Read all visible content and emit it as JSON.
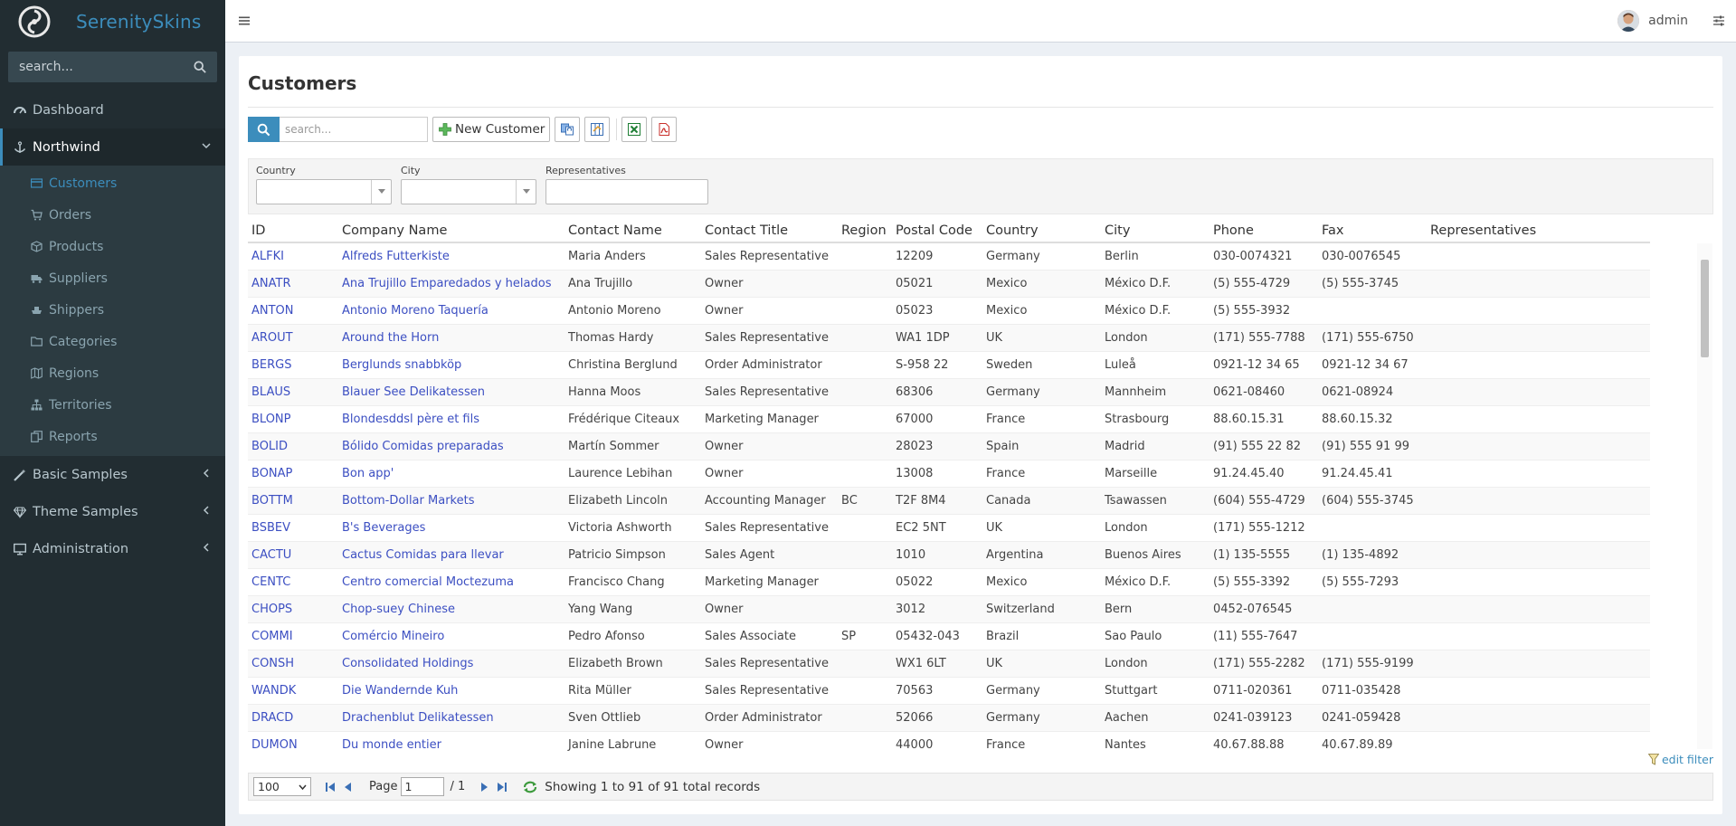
{
  "app": {
    "brand": "SerenitySkins"
  },
  "sidebar": {
    "search_placeholder": "search...",
    "items": [
      {
        "label": "Dashboard"
      },
      {
        "label": "Northwind"
      },
      {
        "label": "Basic Samples"
      },
      {
        "label": "Theme Samples"
      },
      {
        "label": "Administration"
      }
    ],
    "northwind_children": [
      {
        "label": "Customers"
      },
      {
        "label": "Orders"
      },
      {
        "label": "Products"
      },
      {
        "label": "Suppliers"
      },
      {
        "label": "Shippers"
      },
      {
        "label": "Categories"
      },
      {
        "label": "Regions"
      },
      {
        "label": "Territories"
      },
      {
        "label": "Reports"
      }
    ]
  },
  "header": {
    "user_name": "admin"
  },
  "page": {
    "title": "Customers"
  },
  "toolbar": {
    "search_placeholder": "search...",
    "new_button": "New Customer"
  },
  "filters": {
    "country_label": "Country",
    "city_label": "City",
    "representatives_label": "Representatives"
  },
  "grid": {
    "columns": [
      "ID",
      "Company Name",
      "Contact Name",
      "Contact Title",
      "Region",
      "Postal Code",
      "Country",
      "City",
      "Phone",
      "Fax",
      "Representatives"
    ],
    "rows": [
      [
        "ALFKI",
        "Alfreds Futterkiste",
        "Maria Anders",
        "Sales Representative",
        "",
        "12209",
        "Germany",
        "Berlin",
        "030-0074321",
        "030-0076545",
        ""
      ],
      [
        "ANATR",
        "Ana Trujillo Emparedados y helados",
        "Ana Trujillo",
        "Owner",
        "",
        "05021",
        "Mexico",
        "México D.F.",
        "(5) 555-4729",
        "(5) 555-3745",
        ""
      ],
      [
        "ANTON",
        "Antonio Moreno Taquería",
        "Antonio Moreno",
        "Owner",
        "",
        "05023",
        "Mexico",
        "México D.F.",
        "(5) 555-3932",
        "",
        ""
      ],
      [
        "AROUT",
        "Around the Horn",
        "Thomas Hardy",
        "Sales Representative",
        "",
        "WA1 1DP",
        "UK",
        "London",
        "(171) 555-7788",
        "(171) 555-6750",
        ""
      ],
      [
        "BERGS",
        "Berglunds snabbköp",
        "Christina Berglund",
        "Order Administrator",
        "",
        "S-958 22",
        "Sweden",
        "Luleå",
        "0921-12 34 65",
        "0921-12 34 67",
        ""
      ],
      [
        "BLAUS",
        "Blauer See Delikatessen",
        "Hanna Moos",
        "Sales Representative",
        "",
        "68306",
        "Germany",
        "Mannheim",
        "0621-08460",
        "0621-08924",
        ""
      ],
      [
        "BLONP",
        "Blondesddsl père et fils",
        "Frédérique Citeaux",
        "Marketing Manager",
        "",
        "67000",
        "France",
        "Strasbourg",
        "88.60.15.31",
        "88.60.15.32",
        ""
      ],
      [
        "BOLID",
        "Bólido Comidas preparadas",
        "Martín Sommer",
        "Owner",
        "",
        "28023",
        "Spain",
        "Madrid",
        "(91) 555 22 82",
        "(91) 555 91 99",
        ""
      ],
      [
        "BONAP",
        "Bon app'",
        "Laurence Lebihan",
        "Owner",
        "",
        "13008",
        "France",
        "Marseille",
        "91.24.45.40",
        "91.24.45.41",
        ""
      ],
      [
        "BOTTM",
        "Bottom-Dollar Markets",
        "Elizabeth Lincoln",
        "Accounting Manager",
        "BC",
        "T2F 8M4",
        "Canada",
        "Tsawassen",
        "(604) 555-4729",
        "(604) 555-3745",
        ""
      ],
      [
        "BSBEV",
        "B's Beverages",
        "Victoria Ashworth",
        "Sales Representative",
        "",
        "EC2 5NT",
        "UK",
        "London",
        "(171) 555-1212",
        "",
        ""
      ],
      [
        "CACTU",
        "Cactus Comidas para llevar",
        "Patricio Simpson",
        "Sales Agent",
        "",
        "1010",
        "Argentina",
        "Buenos Aires",
        "(1) 135-5555",
        "(1) 135-4892",
        ""
      ],
      [
        "CENTC",
        "Centro comercial Moctezuma",
        "Francisco Chang",
        "Marketing Manager",
        "",
        "05022",
        "Mexico",
        "México D.F.",
        "(5) 555-3392",
        "(5) 555-7293",
        ""
      ],
      [
        "CHOPS",
        "Chop-suey Chinese",
        "Yang Wang",
        "Owner",
        "",
        "3012",
        "Switzerland",
        "Bern",
        "0452-076545",
        "",
        ""
      ],
      [
        "COMMI",
        "Comércio Mineiro",
        "Pedro Afonso",
        "Sales Associate",
        "SP",
        "05432-043",
        "Brazil",
        "Sao Paulo",
        "(11) 555-7647",
        "",
        ""
      ],
      [
        "CONSH",
        "Consolidated Holdings",
        "Elizabeth Brown",
        "Sales Representative",
        "",
        "WX1 6LT",
        "UK",
        "London",
        "(171) 555-2282",
        "(171) 555-9199",
        ""
      ],
      [
        "WANDK",
        "Die Wandernde Kuh",
        "Rita Müller",
        "Sales Representative",
        "",
        "70563",
        "Germany",
        "Stuttgart",
        "0711-020361",
        "0711-035428",
        ""
      ],
      [
        "DRACD",
        "Drachenblut Delikatessen",
        "Sven Ottlieb",
        "Order Administrator",
        "",
        "52066",
        "Germany",
        "Aachen",
        "0241-039123",
        "0241-059428",
        ""
      ],
      [
        "DUMON",
        "Du monde entier",
        "Janine Labrune",
        "Owner",
        "",
        "44000",
        "France",
        "Nantes",
        "40.67.88.88",
        "40.67.89.89",
        ""
      ]
    ]
  },
  "footer": {
    "edit_filter": "edit filter",
    "page_size": "100",
    "page_label": "Page",
    "page_value": "1",
    "page_total": "/ 1",
    "info": "Showing 1 to 91 of 91 total records"
  },
  "colors": {
    "accent": "#3c8dbc",
    "sidebar_bg": "#222d32",
    "link": "#3c4fc2"
  }
}
